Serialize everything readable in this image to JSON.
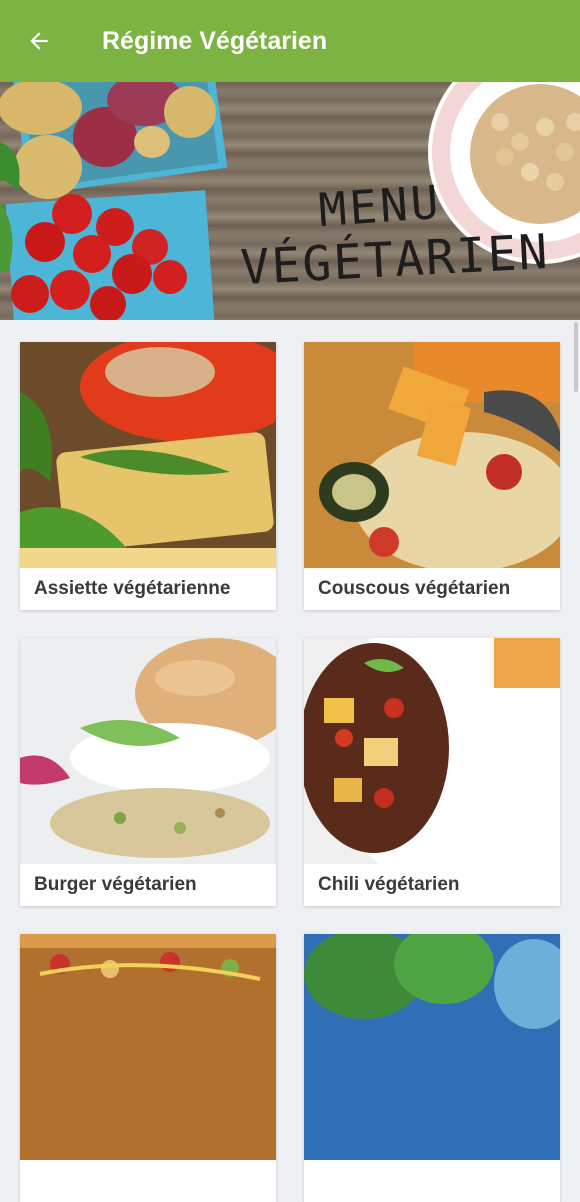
{
  "app": {
    "title": "Régime Végétarien",
    "back_icon": "arrow-left-icon",
    "bar_color": "#7cb342"
  },
  "banner": {
    "line1": "MENU",
    "line2": "VÉGÉTARIEN"
  },
  "recipes": [
    {
      "label": "Assiette végétarienne"
    },
    {
      "label": "Couscous végétarien"
    },
    {
      "label": "Burger végétarien"
    },
    {
      "label": "Chili végétarien"
    }
  ]
}
